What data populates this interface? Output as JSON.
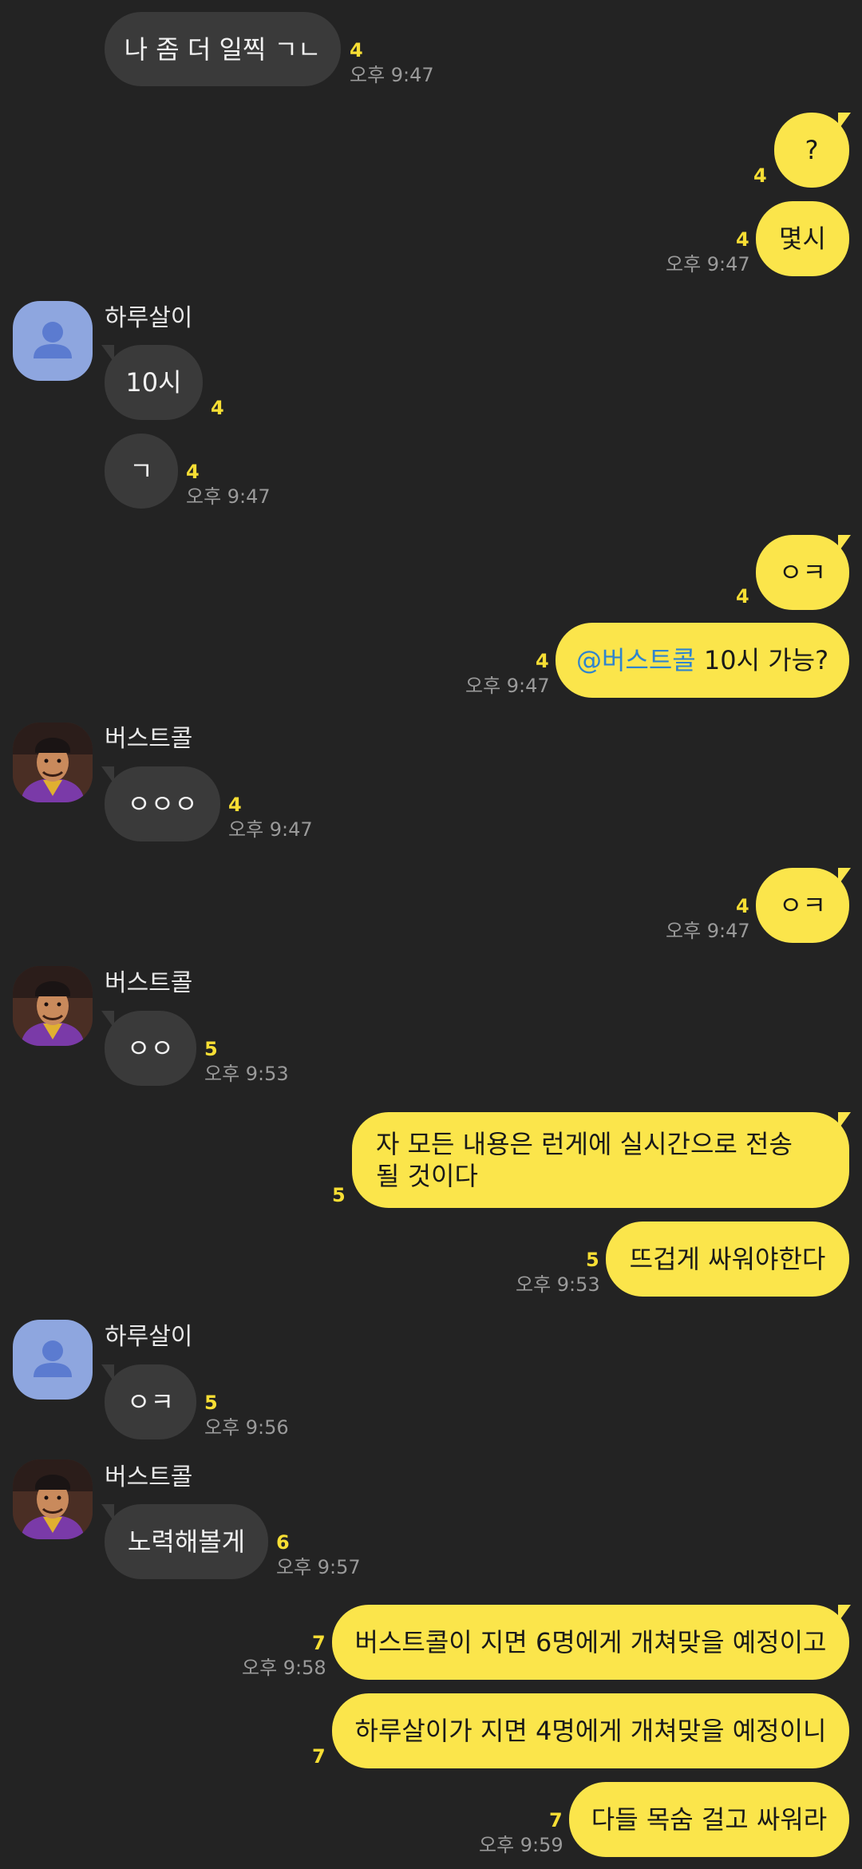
{
  "colors": {
    "background": "#232323",
    "incoming_bubble": "#3a3a3a",
    "outgoing_bubble": "#fbe54b",
    "unread_count": "#f7de34",
    "timestamp": "#9a9a9a",
    "mention": "#2f84ce",
    "default_avatar": "#8ea6df"
  },
  "avatars": {
    "default": {
      "icon": "person-silhouette-icon"
    },
    "photo": {
      "icon": "profile-photo"
    }
  },
  "messages": [
    {
      "side": "in",
      "text": "나 좀 더 일찍 ㄱㄴ",
      "unread": "4",
      "time": "오후 9:47"
    },
    {
      "side": "out",
      "text": "?",
      "unread": "4"
    },
    {
      "side": "out",
      "text": "몇시",
      "unread": "4",
      "time": "오후 9:47"
    },
    {
      "side": "in",
      "sender": "하루살이",
      "avatar": "default",
      "text": "10시",
      "unread": "4"
    },
    {
      "side": "in",
      "text": "ㄱ",
      "unread": "4",
      "time": "오후 9:47"
    },
    {
      "side": "out",
      "text": "ㅇㅋ",
      "unread": "4"
    },
    {
      "side": "out",
      "mention": "@버스트콜",
      "text": " 10시 가능?",
      "unread": "4",
      "time": "오후 9:47"
    },
    {
      "side": "in",
      "sender": "버스트콜",
      "avatar": "photo",
      "text": "ㅇㅇㅇ",
      "unread": "4",
      "time": "오후 9:47"
    },
    {
      "side": "out",
      "text": "ㅇㅋ",
      "unread": "4",
      "time": "오후 9:47"
    },
    {
      "side": "in",
      "sender": "버스트콜",
      "avatar": "photo",
      "text": "ㅇㅇ",
      "unread": "5",
      "time": "오후 9:53"
    },
    {
      "side": "out",
      "text": "자 모든 내용은 런게에 실시간으로 전송 될 것이다",
      "unread": "5"
    },
    {
      "side": "out",
      "text": "뜨겁게 싸워야한다",
      "unread": "5",
      "time": "오후 9:53"
    },
    {
      "side": "in",
      "sender": "하루살이",
      "avatar": "default",
      "text": "ㅇㅋ",
      "unread": "5",
      "time": "오후 9:56"
    },
    {
      "side": "in",
      "sender": "버스트콜",
      "avatar": "photo",
      "text": "노력해볼게",
      "unread": "6",
      "time": "오후 9:57"
    },
    {
      "side": "out",
      "text": "버스트콜이 지면 6명에게 개쳐맞을 예정이고",
      "unread": "7",
      "time": "오후 9:58"
    },
    {
      "side": "out",
      "text": "하루살이가 지면 4명에게 개쳐맞을 예정이니",
      "unread": "7"
    },
    {
      "side": "out",
      "text": "다들 목숨 걸고 싸워라",
      "unread": "7",
      "time": "오후 9:59"
    }
  ]
}
